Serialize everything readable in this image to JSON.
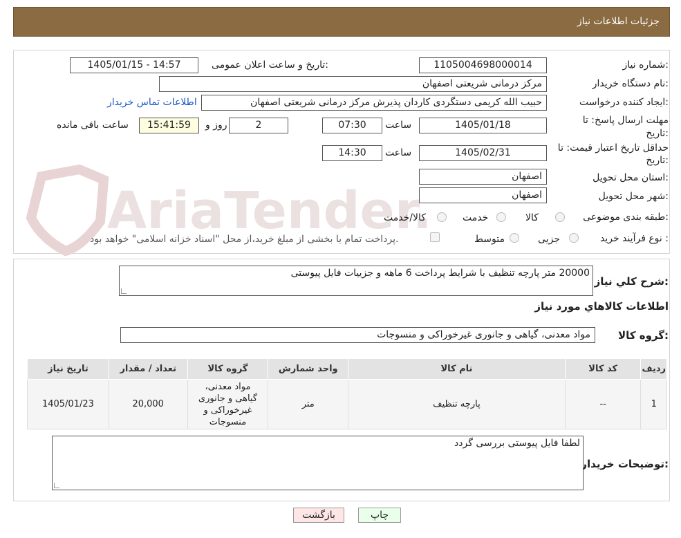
{
  "header": {
    "title": "جزئیات اطلاعات نیاز"
  },
  "form": {
    "need_number_label": "شماره نیاز:",
    "need_number": "1105004698000014",
    "announce_label": "تاریخ و ساعت اعلان عمومی:",
    "announce_value": "1405/01/15 - 14:57",
    "buyer_org_label": "نام دستگاه خریدار:",
    "buyer_org": "مرکز درمانی شریعتی اصفهان",
    "creator_label": "ایجاد کننده درخواست:",
    "creator": "حبیب الله کریمی دستگردی کاردان پذیرش مرکز درمانی شریعتی اصفهان",
    "contact_link": "اطلاعات تماس خریدار",
    "deadline_label_1": "مهلت ارسال پاسخ: تا",
    "deadline_label_2": "تاریخ:",
    "deadline_date": "1405/01/18",
    "time_label": "ساعت",
    "deadline_time": "07:30",
    "days_value": "2",
    "days_label": "روز و",
    "remaining_value": "15:41:59",
    "remaining_label": "ساعت باقی مانده",
    "validity_label_1": "حداقل تاریخ اعتبار قیمت: تا",
    "validity_label_2": "تاریخ:",
    "validity_date": "1405/02/31",
    "validity_time_label": "ساعت",
    "validity_time": "14:30",
    "province_label": "استان محل تحویل:",
    "province": "اصفهان",
    "city_label": "شهر محل تحویل:",
    "city": "اصفهان",
    "category_label": "طبقه بندی موضوعی:",
    "category_options": [
      "کالا",
      "خدمت",
      "کالا/خدمت"
    ],
    "process_label": "نوع فرآیند خرید :",
    "process_options": [
      "جزیی",
      "متوسط"
    ],
    "payment_note": "پرداخت تمام یا بخشی از مبلغ خرید،از محل \"اسناد خزانه اسلامی\" خواهد بود."
  },
  "summary": {
    "label": "شرح کلي نياز:",
    "text": "20000 متر پارچه تنظیف با شرایط پرداخت 6 ماهه و جزییات فایل پیوستی",
    "items_title": "اطلاعات کالاهاي مورد نياز",
    "group_label": "گروه کالا:",
    "group_value": "مواد معدنی، گیاهی و جانوری غیرخوراکی و منسوجات"
  },
  "table": {
    "headers": [
      "ردیف",
      "کد کالا",
      "نام کالا",
      "واحد شمارش",
      "گروه کالا",
      "تعداد / مقدار",
      "تاریخ نیاز"
    ],
    "rows": [
      [
        "1",
        "--",
        "پارچه تنظیف",
        "متر",
        "مواد معدنی، گیاهی و جانوری غیرخوراکی و منسوجات",
        "20,000",
        "1405/01/23"
      ]
    ]
  },
  "notes": {
    "label": "توضیحات خریدار:",
    "text": "لطفا فایل پیوستی بررسی گردد"
  },
  "buttons": {
    "print": "چاپ",
    "back": "بازگشت"
  },
  "watermark": {
    "text": "AriaTender.neT"
  },
  "colors": {
    "header_bg": "#8b6b42",
    "link": "#1a55c6",
    "print_bg": "#eaffea",
    "back_bg": "#ffe6e6"
  }
}
